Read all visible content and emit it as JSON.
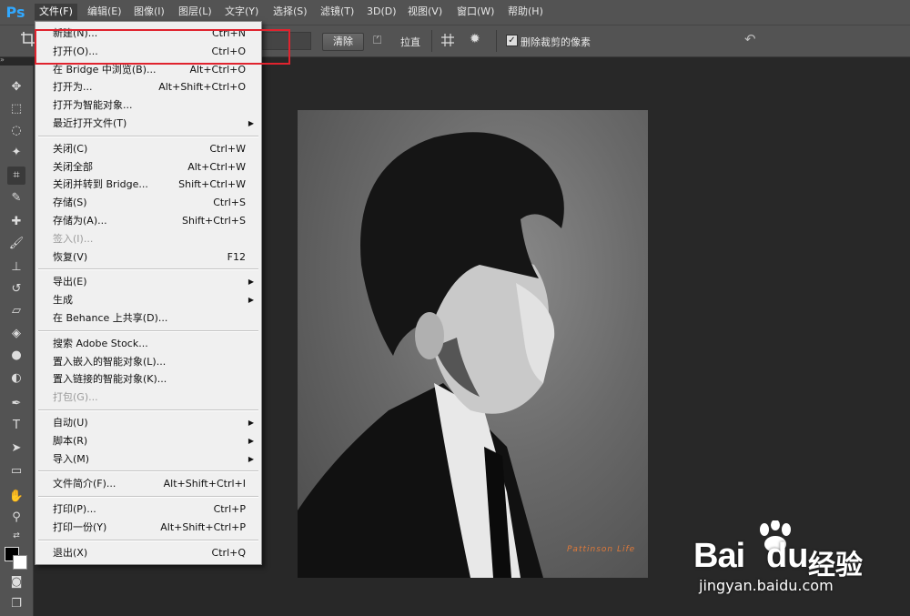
{
  "app": {
    "logo": "Ps",
    "accent": "#31a8ff"
  },
  "menubar": [
    {
      "label": "文件(F)",
      "active": true
    },
    {
      "label": "编辑(E)"
    },
    {
      "label": "图像(I)"
    },
    {
      "label": "图层(L)"
    },
    {
      "label": "文字(Y)"
    },
    {
      "label": "选择(S)"
    },
    {
      "label": "滤镜(T)"
    },
    {
      "label": "3D(D)"
    },
    {
      "label": "视图(V)"
    },
    {
      "label": "窗口(W)"
    },
    {
      "label": "帮助(H)"
    }
  ],
  "options": {
    "clear_label": "清除",
    "straighten_label": "拉直",
    "delete_cropped_label": "删除裁剪的像素",
    "delete_cropped_checked": true
  },
  "file_menu": {
    "groups": [
      [
        {
          "label": "新建(N)...",
          "shortcut": "Ctrl+N"
        },
        {
          "label": "打开(O)...",
          "shortcut": "Ctrl+O"
        },
        {
          "label": "在 Bridge 中浏览(B)...",
          "shortcut": "Alt+Ctrl+O"
        },
        {
          "label": "打开为...",
          "shortcut": "Alt+Shift+Ctrl+O"
        },
        {
          "label": "打开为智能对象...",
          "shortcut": ""
        },
        {
          "label": "最近打开文件(T)",
          "shortcut": "",
          "submenu": true
        }
      ],
      [
        {
          "label": "关闭(C)",
          "shortcut": "Ctrl+W"
        },
        {
          "label": "关闭全部",
          "shortcut": "Alt+Ctrl+W"
        },
        {
          "label": "关闭并转到 Bridge...",
          "shortcut": "Shift+Ctrl+W"
        },
        {
          "label": "存储(S)",
          "shortcut": "Ctrl+S"
        },
        {
          "label": "存储为(A)...",
          "shortcut": "Shift+Ctrl+S"
        },
        {
          "label": "签入(I)...",
          "shortcut": "",
          "disabled": true
        },
        {
          "label": "恢复(V)",
          "shortcut": "F12"
        }
      ],
      [
        {
          "label": "导出(E)",
          "shortcut": "",
          "submenu": true
        },
        {
          "label": "生成",
          "shortcut": "",
          "submenu": true
        },
        {
          "label": "在 Behance 上共享(D)...",
          "shortcut": ""
        }
      ],
      [
        {
          "label": "搜索 Adobe Stock...",
          "shortcut": ""
        },
        {
          "label": "置入嵌入的智能对象(L)...",
          "shortcut": ""
        },
        {
          "label": "置入链接的智能对象(K)...",
          "shortcut": ""
        },
        {
          "label": "打包(G)...",
          "shortcut": "",
          "disabled": true
        }
      ],
      [
        {
          "label": "自动(U)",
          "shortcut": "",
          "submenu": true
        },
        {
          "label": "脚本(R)",
          "shortcut": "",
          "submenu": true
        },
        {
          "label": "导入(M)",
          "shortcut": "",
          "submenu": true
        }
      ],
      [
        {
          "label": "文件简介(F)...",
          "shortcut": "Alt+Shift+Ctrl+I"
        }
      ],
      [
        {
          "label": "打印(P)...",
          "shortcut": "Ctrl+P"
        },
        {
          "label": "打印一份(Y)",
          "shortcut": "Alt+Shift+Ctrl+P"
        }
      ],
      [
        {
          "label": "退出(X)",
          "shortcut": "Ctrl+Q"
        }
      ]
    ]
  },
  "document": {
    "signature": "Pattinson Life"
  },
  "watermark": {
    "brand": "Bai",
    "brand2": "du",
    "product": "经验",
    "url": "jingyan.baidu.com"
  }
}
